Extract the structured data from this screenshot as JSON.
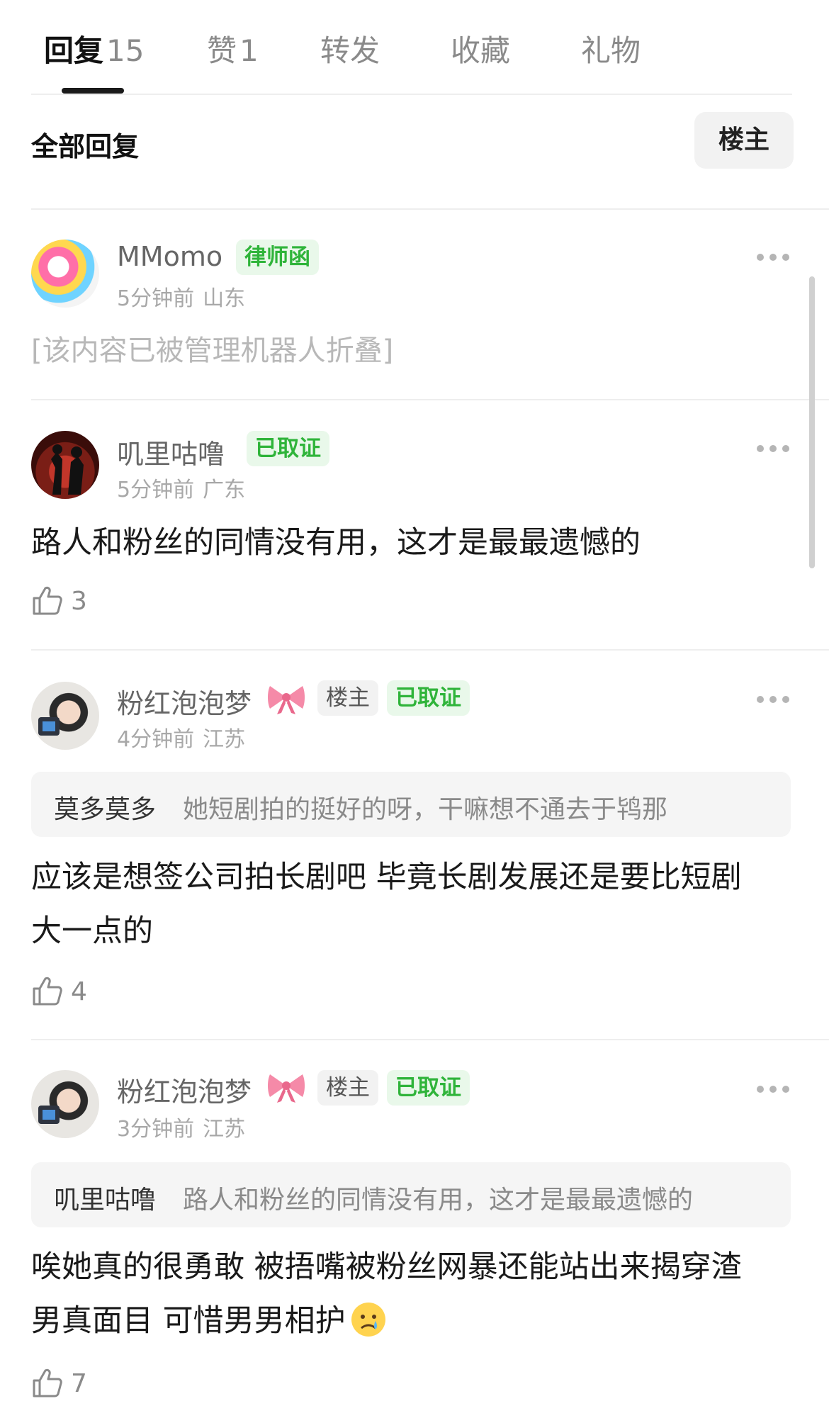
{
  "tabs": [
    {
      "label": "回复",
      "count": "15"
    },
    {
      "label": "赞",
      "count": "1"
    },
    {
      "label": "转发",
      "count": ""
    },
    {
      "label": "收藏",
      "count": ""
    },
    {
      "label": "礼物",
      "count": ""
    }
  ],
  "filter": {
    "title": "全部回复",
    "owner_button": "楼主"
  },
  "comments": [
    {
      "username": "MMomo",
      "badges": [
        "律师函"
      ],
      "time": "5分钟前",
      "location": "山东",
      "content": "[该内容已被管理机器人折叠]"
    },
    {
      "username": "叽里咕噜",
      "badges": [
        "已取证"
      ],
      "time": "5分钟前",
      "location": "广东",
      "content": "路人和粉丝的同情没有用，这才是最最遗憾的",
      "likes": "3"
    },
    {
      "username": "粉红泡泡梦",
      "badges": [
        "楼主",
        "已取证"
      ],
      "time": "4分钟前",
      "location": "江苏",
      "quote_name": "莫多莫多",
      "quote_text": "她短剧拍的挺好的呀，干嘛想不通去于鸨那",
      "content": "应该是想签公司拍长剧吧 毕竟长剧发展还是要比短剧大一点的",
      "likes": "4"
    },
    {
      "username": "粉红泡泡梦",
      "badges": [
        "楼主",
        "已取证"
      ],
      "time": "3分钟前",
      "location": "江苏",
      "quote_name": "叽里咕噜",
      "quote_text": "路人和粉丝的同情没有用，这才是最最遗憾的",
      "content": "唉她真的很勇敢 被捂嘴被粉丝网暴还能站出来揭穿渣男真面目 可惜男男相护",
      "likes": "7"
    }
  ],
  "colors": {
    "accent_green": "#2fb43a",
    "badge_green_bg": "#e9f8ea",
    "muted": "#a8a8a8"
  },
  "icons": {
    "like": "thumbs-up-icon",
    "more": "more-dots-icon",
    "bow": "ribbon-bow-emoji",
    "cry": "sad-tear-emoji"
  }
}
